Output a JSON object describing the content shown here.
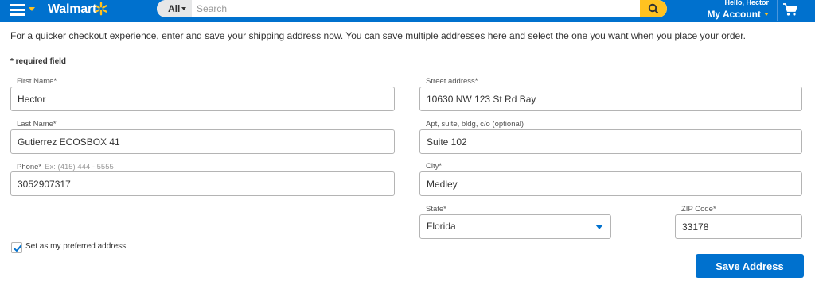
{
  "header": {
    "logo_text": "Walmart",
    "search": {
      "department": "All",
      "placeholder": "Search"
    },
    "account": {
      "greeting": "Hello, Hector",
      "label": "My Account"
    },
    "colors": {
      "brand_blue": "#0071ce",
      "spark_yellow": "#ffc220"
    },
    "icons": [
      "hamburger-menu-icon",
      "walmart-spark-icon",
      "search-icon",
      "cart-icon"
    ]
  },
  "form": {
    "intro": "For a quicker checkout experience, enter and save your shipping address now. You can save multiple addresses here and select the one you want when you place your order.",
    "required_note": "* required field",
    "first_name": {
      "label": "First Name*",
      "value": "Hector"
    },
    "last_name": {
      "label": "Last Name*",
      "value": "Gutierrez ECOSBOX 41"
    },
    "phone": {
      "label": "Phone*",
      "hint": "Ex: (415) 444 - 5555",
      "value": "3052907317"
    },
    "street": {
      "label": "Street address*",
      "value": "10630 NW 123 St Rd Bay"
    },
    "apt": {
      "label": "Apt, suite, bldg, c/o (optional)",
      "value": "Suite 102"
    },
    "city": {
      "label": "City*",
      "value": "Medley"
    },
    "state": {
      "label": "State*",
      "value": "Florida"
    },
    "zip": {
      "label": "ZIP Code*",
      "value": "33178"
    },
    "preferred": {
      "label": "Set as my preferred address",
      "checked": true
    },
    "save_label": "Save Address"
  }
}
